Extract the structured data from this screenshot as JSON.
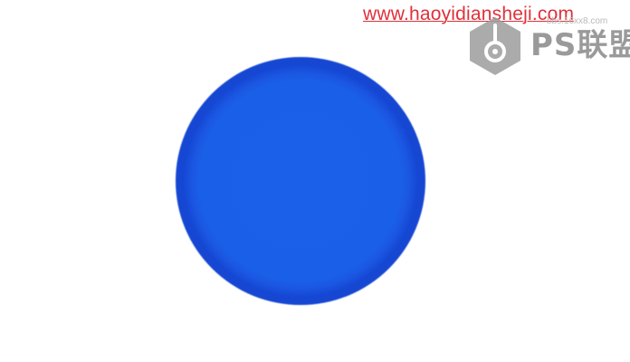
{
  "image": {
    "shape": "circle",
    "fill_color": "#1a5ee6",
    "edge_color": "#1447d4",
    "background_color": "#ffffff"
  },
  "watermark": {
    "url": "www.haoyidiansheji.com",
    "url_color": "#e0303a",
    "logo_small_text": "bbs.16xx8.com",
    "logo_text": "PS联盟",
    "logo_color": "#9a9a9a"
  }
}
